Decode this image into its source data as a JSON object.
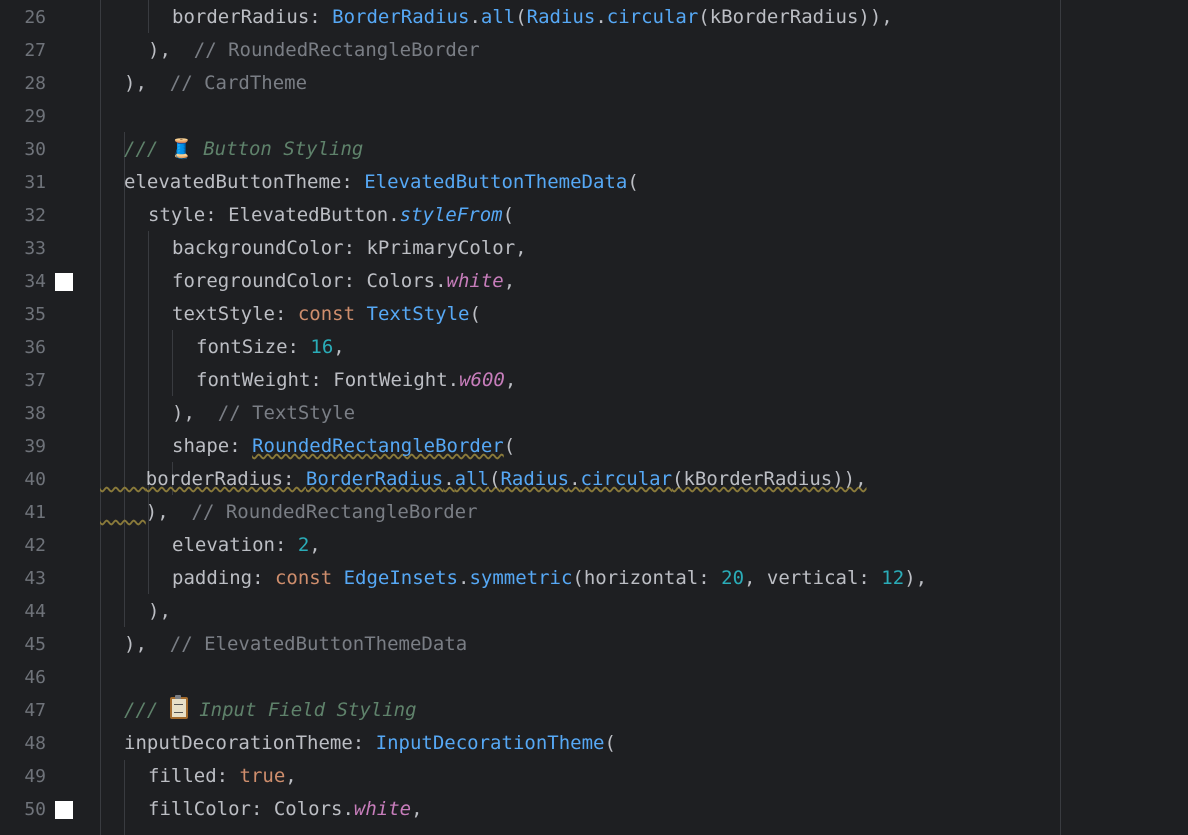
{
  "editor": {
    "line_numbers": [
      "26",
      "27",
      "28",
      "29",
      "30",
      "31",
      "32",
      "33",
      "34",
      "35",
      "36",
      "37",
      "38",
      "39",
      "40",
      "41",
      "42",
      "43",
      "44",
      "45",
      "46",
      "47",
      "48",
      "49",
      "50"
    ],
    "lines": {
      "l26": {
        "a": "borderRadius: ",
        "b": "BorderRadius",
        "c": ".",
        "d": "all",
        "e": "(",
        "f": "Radius",
        "g": ".",
        "h": "circular",
        "i": "(kBorderRadius)),"
      },
      "l27": {
        "a": "),  ",
        "comment": "// RoundedRectangleBorder"
      },
      "l28": {
        "a": "),  ",
        "comment": "// CardTheme"
      },
      "l30": {
        "doc_prefix": "/// ",
        "emoji": "🧵",
        "doc_text": " Button Styling"
      },
      "l31": {
        "a": "elevatedButtonTheme: ",
        "b": "ElevatedButtonThemeData",
        "c": "("
      },
      "l32": {
        "a": "style: ElevatedButton.",
        "b": "styleFrom",
        "c": "("
      },
      "l33": {
        "a": "backgroundColor: kPrimaryColor,"
      },
      "l34": {
        "a": "foregroundColor: Colors.",
        "b": "white",
        "c": ","
      },
      "l35": {
        "a": "textStyle: ",
        "kw": "const",
        "sp": " ",
        "b": "TextStyle",
        "c": "("
      },
      "l36": {
        "a": "fontSize: ",
        "num": "16",
        "c": ","
      },
      "l37": {
        "a": "fontWeight: FontWeight.",
        "b": "w600",
        "c": ","
      },
      "l38": {
        "a": "),  ",
        "comment": "// TextStyle"
      },
      "l39": {
        "a": "shape: ",
        "b": "RoundedRectangleBorder",
        "c": "("
      },
      "l40": {
        "a": "borderRadius: ",
        "b": "BorderRadius",
        "c": ".",
        "d": "all",
        "e": "(",
        "f": "Radius",
        "g": ".",
        "h": "circular",
        "i": "(kBorderRadius)),"
      },
      "l41": {
        "a": "),  ",
        "comment": "// RoundedRectangleBorder"
      },
      "l42": {
        "a": "elevation: ",
        "num": "2",
        "c": ","
      },
      "l43": {
        "a": "padding: ",
        "kw": "const",
        "sp": " ",
        "b": "EdgeInsets",
        "c": ".",
        "d": "symmetric",
        "e": "(horizontal: ",
        "n1": "20",
        "f": ", vertical: ",
        "n2": "12",
        "g": "),"
      },
      "l44": {
        "a": "),"
      },
      "l45": {
        "a": "),  ",
        "comment": "// ElevatedButtonThemeData"
      },
      "l47": {
        "doc_prefix": "/// ",
        "doc_text": " Input Field Styling"
      },
      "l48": {
        "a": "inputDecorationTheme: ",
        "b": "InputDecorationTheme",
        "c": "("
      },
      "l49": {
        "a": "filled: ",
        "kw": "true",
        "c": ","
      },
      "l50": {
        "a": "fillColor: Colors.",
        "b": "white",
        "c": ","
      }
    },
    "icons": {
      "spool": "thread-spool-icon",
      "clipboard": "clipboard-icon",
      "gutter_marker": "color-swatch-white-icon"
    },
    "colors": {
      "background": "#1e1f22",
      "keyword": "#cf8e6d",
      "class": "#56a8f5",
      "number": "#2aacb8",
      "italic_member": "#c77dbb",
      "comment": "#7a7e85",
      "doc_comment": "#5f826b",
      "swatch_white": "#ffffff"
    }
  }
}
